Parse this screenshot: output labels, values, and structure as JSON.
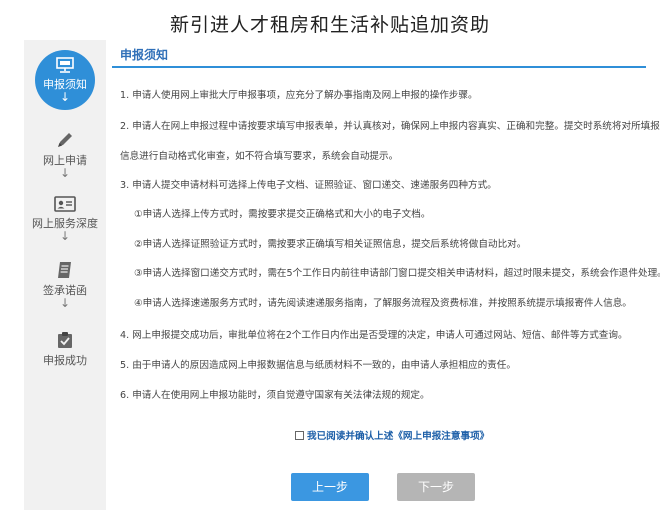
{
  "page": {
    "title": "新引进人才租房和生活补贴追加资助"
  },
  "sidebar": {
    "steps": [
      {
        "label": "申报须知",
        "icon": "monitor-icon",
        "active": true
      },
      {
        "label": "网上申请",
        "icon": "pencil-icon",
        "active": false
      },
      {
        "label": "网上服务深度",
        "icon": "id-card-icon",
        "active": false
      },
      {
        "label": "签承诺函",
        "icon": "document-icon",
        "active": false
      },
      {
        "label": "申报成功",
        "icon": "clipboard-check-icon",
        "active": false
      }
    ],
    "arrow": "↓"
  },
  "section": {
    "title": "申报须知"
  },
  "paragraphs": [
    "1. 申请人使用网上审批大厅申报事项，应充分了解办事指南及网上申报的操作步骤。",
    "2. 申请人在网上申报过程中请按要求填写申报表单，并认真核对，确保网上申报内容真实、正确和完整。提交时系统将对所填报",
    "信息进行自动格式化审查，如不符合填写要求，系统会自动提示。",
    "3. 申请人提交申请材料可选择上传电子文档、证照验证、窗口递交、速递服务四种方式。",
    "①申请人选择上传方式时，需按要求提交正确格式和大小的电子文档。",
    "②申请人选择证照验证方式时，需按要求正确填写相关证照信息，提交后系统将做自动比对。",
    "③申请人选择窗口递交方式时，需在5个工作日内前往申请部门窗口提交相关申请材料，超过时限未提交，系统会作退件处理。",
    "④申请人选择速递服务方式时，请先阅读速递服务指南，了解服务流程及资费标准，并按照系统提示填报寄件人信息。",
    "4. 网上申报提交成功后，审批单位将在2个工作日内作出是否受理的决定，申请人可通过网站、短信、邮件等方式查询。",
    "5. 由于申请人的原因造成网上申报数据信息与纸质材料不一致的，由申请人承担相应的责任。",
    "6. 申请人在使用网上申报功能时，须自觉遵守国家有关法律法规的规定。"
  ],
  "agree": {
    "label": "我已阅读并确认上述《网上申报注意事项》"
  },
  "buttons": {
    "prev": "上一步",
    "next": "下一步"
  }
}
